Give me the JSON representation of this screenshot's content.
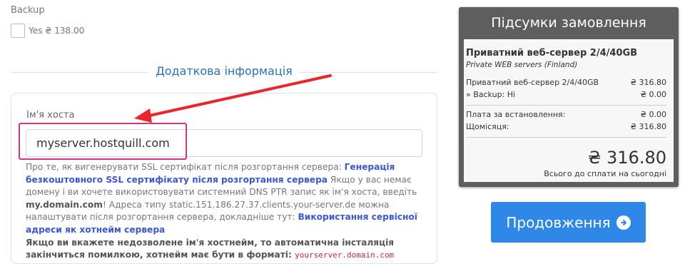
{
  "addons": {
    "backup_label": "Backup",
    "backup_option": "Yes ₴ 138.00"
  },
  "additional_info": {
    "title": "Додаткова інформація",
    "hostname_label": "Ім'я хоста",
    "hostname_value": "myserver.hostquill.com",
    "help": {
      "p1": "Про те, як вигенерувати SSL сертифікат після розгортання сервера: ",
      "link1": "Генерація безкоштовного SSL сертифікату після розгортання сервера",
      "p2": " Якщо у вас немає домену і ви хочете використовувати системний DNS PTR запис як ім'я хоста, введіть ",
      "example_host": "my.domain.com",
      "p3": "! Адреса типу static.151.186.27.37.clients.your-server.de можна налаштувати після розгортання сервера, докладніше тут: ",
      "link2": "Використання сервісної адреси як хотнейм сервера",
      "warning": "Якщо ви вкажете недозволене ім'я хостнейм, то автоматична інсталяція закінчиться помилкою, хотнейм має бути в форматі: ",
      "format": "yourserver.domain.com"
    }
  },
  "summary": {
    "title": "Підсумки замовлення",
    "product_name": "Приватний веб-сервер 2/4/40GB",
    "product_group": "Private WEB servers (Finland)",
    "lines": [
      {
        "label": "Приватний веб-сервер 2/4/40GB",
        "value": "₴ 316.80"
      },
      {
        "label": "» Backup: Ні",
        "value": "₴ 0.00"
      }
    ],
    "fees": [
      {
        "label": "Плата за встановлення:",
        "value": "₴ 0.00"
      },
      {
        "label": "Щомісяця:",
        "value": "₴ 316.80"
      }
    ],
    "total": "₴ 316.80",
    "total_caption": "Всього до сплати на сьогодні"
  },
  "continue_label": "Продовження",
  "colors": {
    "accent": "#2f88e8",
    "annotation_arrow": "#e8262b",
    "annotation_box": "#d63384"
  },
  "icons": {
    "continue": "arrow-circle-right-icon"
  }
}
